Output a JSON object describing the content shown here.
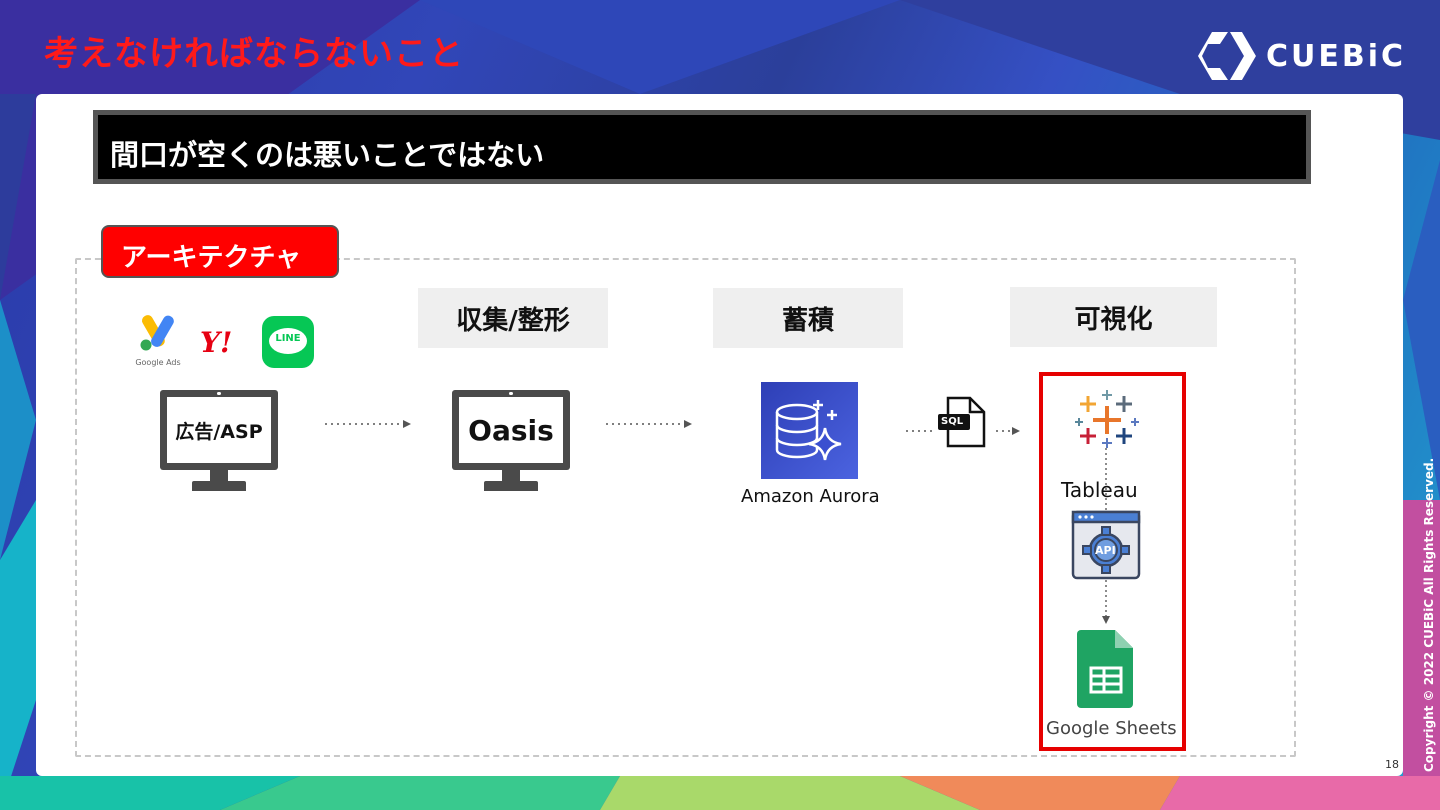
{
  "slide": {
    "title": "考えなければならないこと",
    "headline": "間口が空くのは悪いことではない",
    "page_number": "18",
    "copyright": "Copyright © 2022 CUEBiC All Rights Reserved."
  },
  "logo": {
    "text": "CUEBiC"
  },
  "badge": {
    "label": "アーキテクチャ"
  },
  "stages": [
    {
      "label": "収集/整形"
    },
    {
      "label": "蓄積"
    },
    {
      "label": "可視化"
    }
  ],
  "source_icons": {
    "google_ads_caption": "Google Ads",
    "yahoo_text": "Y!",
    "line_text": "LINE"
  },
  "nodes": {
    "ads": "広告/ASP",
    "oasis": "Oasis",
    "aurora": "Amazon Aurora",
    "sql": "SQL",
    "tableau": "Tableau",
    "api": "API",
    "sheets": "Google Sheets"
  },
  "colors": {
    "title_red": "#ff1a1a",
    "badge_red": "#ff0000",
    "frame_red": "#e60000",
    "aurora_blue": "#3a4fd0",
    "sheets_green": "#1fa463"
  }
}
